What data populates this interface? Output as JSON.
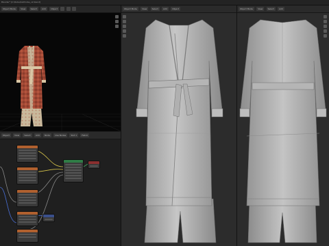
{
  "app": {
    "title": "Blender* [C:\\Robe\\bathrobe_v2.blend]"
  },
  "render_view": {
    "header_buttons": [
      "Object Mode",
      "View",
      "Select",
      "Add",
      "Object"
    ],
    "icons": [
      "viewport-shading-icon",
      "overlay-icon",
      "gizmo-icon"
    ]
  },
  "node_editor": {
    "header_buttons": [
      "Object",
      "View",
      "Select",
      "Add",
      "Node",
      "Use Nodes",
      "Slot 1",
      "Fabric"
    ],
    "nodes": [
      {
        "name": "image-texture-base-color",
        "color": "#b0602f"
      },
      {
        "name": "image-texture-roughness",
        "color": "#b0602f"
      },
      {
        "name": "image-texture-normal",
        "color": "#b0602f"
      },
      {
        "name": "image-texture-metallic",
        "color": "#b0602f"
      },
      {
        "name": "image-texture-alpha",
        "color": "#b0602f"
      },
      {
        "name": "principled-bsdf",
        "color": "#2f7d46"
      },
      {
        "name": "material-output",
        "color": "#8a2f2f"
      },
      {
        "name": "normal-map",
        "color": "#3a4f8a"
      }
    ]
  },
  "front_view": {
    "header_buttons": [
      "Object Mode",
      "View",
      "Select",
      "Add",
      "Object"
    ]
  },
  "back_view": {
    "header_buttons": [
      "Object Mode",
      "View",
      "Select",
      "Add",
      "Object"
    ]
  },
  "colors": {
    "robe_red": "#a24936",
    "robe_cream": "#c9b99c",
    "clay": "#bcbcbc",
    "node_link_yellow": "#d6c34a",
    "node_link_blue": "#4a6fd6"
  }
}
